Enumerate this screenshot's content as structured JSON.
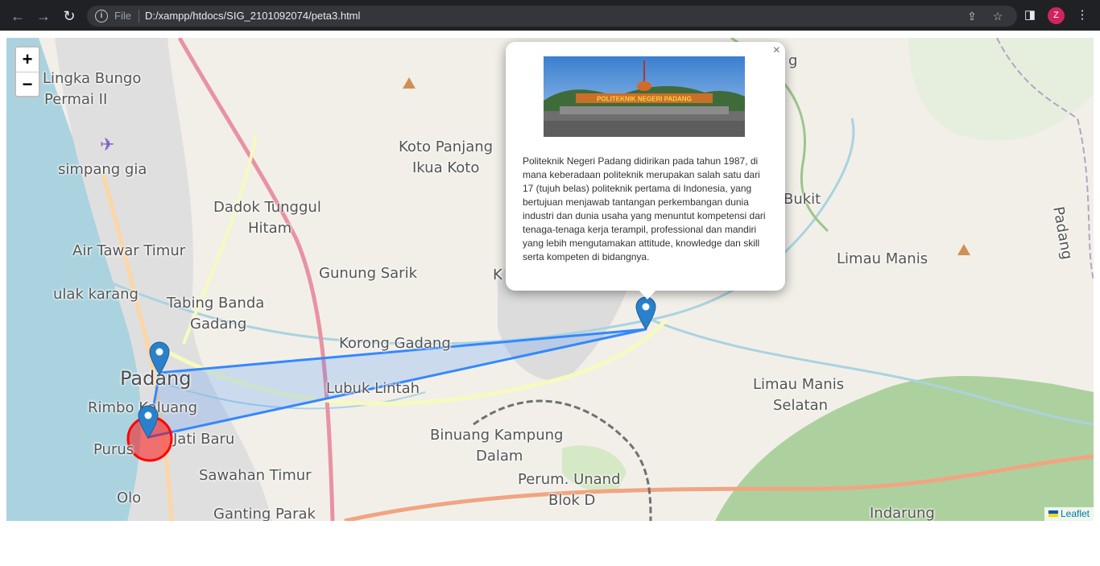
{
  "browser": {
    "file_label": "File",
    "url": "D:/xampp/htdocs/SIG_2101092074/peta3.html",
    "avatar_letter": "Z"
  },
  "map": {
    "zoom_in": "+",
    "zoom_out": "−",
    "places": {
      "p1": "Lingka Bungo",
      "p2": "Permai II",
      "p3": "simpang gia",
      "p4": "Koto Panjang",
      "p5": "Ikua Koto",
      "p6": "Dadok Tunggul",
      "p7": "Hitam",
      "p8": "Air Tawar Timur",
      "p9": "Gunung Sarik",
      "p10": "ulak karang",
      "p11": "Tabing Banda",
      "p12": "Gadang",
      "p13": "Korong Gadang",
      "p14": "Padang",
      "p15": "Lubuk Lintah",
      "p16": "Rimbo Kaluang",
      "p17": "Jati Baru",
      "p18": "Purus",
      "p19": "Binuang Kampung",
      "p20": "Dalam",
      "p21": "Sawahan Timur",
      "p22": "Perum. Unand",
      "p23": "Blok D",
      "p24": "Olo",
      "p25": "Ganting Parak",
      "p26": "Bukit",
      "p27": "Limau Manis",
      "p28": "Limau Manis",
      "p29": "Selatan",
      "p30": "Indarung",
      "p31": "Padang",
      "p32": "g",
      "p33": "K"
    },
    "popup": {
      "close": "×",
      "image_caption": "POLITEKNIK NEGERI PADANG",
      "text": "Politeknik Negeri Padang didirikan pada tahun 1987, di mana keberadaan politeknik merupakan salah satu dari 17 (tujuh belas) politeknik pertama di Indonesia, yang bertujuan menjawab tantangan perkembangan dunia industri dan dunia usaha yang menuntut kompetensi dari tenaga-tenaga kerja terampil, professional dan mandiri yang lebih mengutamakan attitude, knowledge dan skill serta kompeten di bidangnya."
    },
    "attribution": "Leaflet",
    "colors": {
      "polygon": "#3388ff",
      "circle": "#ff0000",
      "marker": "#2a81cb"
    }
  }
}
